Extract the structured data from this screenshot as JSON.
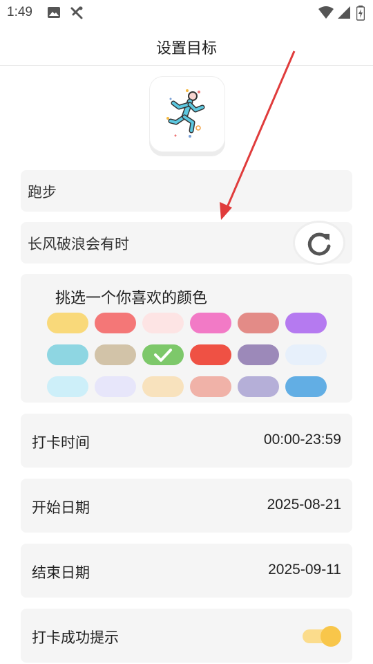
{
  "status_bar": {
    "time": "1:49",
    "icons": [
      "image-icon",
      "no-signal-antenna-icon",
      "wifi-icon",
      "cellular-signal-icon",
      "battery-icon"
    ]
  },
  "header": {
    "title": "设置目标"
  },
  "goal_icon": {
    "name": "running-person-icon"
  },
  "goal_name": {
    "value": "跑步"
  },
  "motto": {
    "value": "长风破浪会有时",
    "refresh_icon": "refresh-icon"
  },
  "color_picker": {
    "title": "挑选一个你喜欢的颜色",
    "selected_index": 8,
    "swatches": [
      "#f9d97a",
      "#f47777",
      "#fde4e4",
      "#f27ac6",
      "#e38b87",
      "#b57af0",
      "#8ed6e2",
      "#d2c3a8",
      "#7dc86a",
      "#ef5144",
      "#9c89b9",
      "#e7f0fb",
      "#cdeff9",
      "#e7e6fa",
      "#f8e2bd",
      "#f0b2a8",
      "#b5afd8",
      "#62aee4"
    ]
  },
  "checkin_time": {
    "label": "打卡时间",
    "value": "00:00-23:59"
  },
  "start_date": {
    "label": "开始日期",
    "value": "2025-08-21"
  },
  "end_date": {
    "label": "结束日期",
    "value": "2025-09-11"
  },
  "success_tip": {
    "label": "打卡成功提示",
    "enabled": true
  },
  "colors": {
    "annotation_arrow": "#e03c3c",
    "field_bg": "#f5f5f5",
    "toggle_on": "#f8c64a"
  }
}
